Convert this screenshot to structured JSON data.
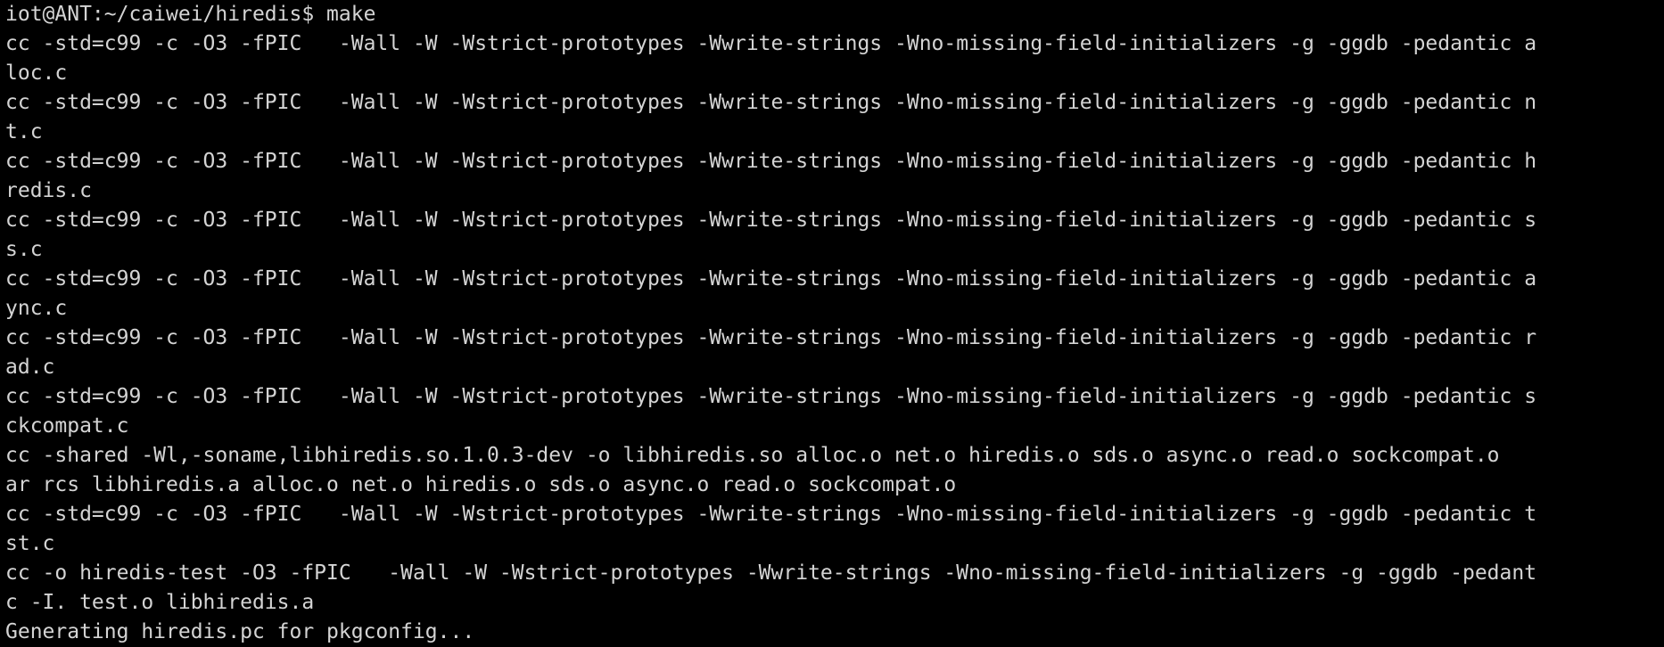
{
  "terminal": {
    "lines": [
      "iot@ANT:~/caiwei/hiredis$ make",
      "cc -std=c99 -c -O3 -fPIC   -Wall -W -Wstrict-prototypes -Wwrite-strings -Wno-missing-field-initializers -g -ggdb -pedantic a",
      "loc.c",
      "cc -std=c99 -c -O3 -fPIC   -Wall -W -Wstrict-prototypes -Wwrite-strings -Wno-missing-field-initializers -g -ggdb -pedantic n",
      "t.c",
      "cc -std=c99 -c -O3 -fPIC   -Wall -W -Wstrict-prototypes -Wwrite-strings -Wno-missing-field-initializers -g -ggdb -pedantic h",
      "redis.c",
      "cc -std=c99 -c -O3 -fPIC   -Wall -W -Wstrict-prototypes -Wwrite-strings -Wno-missing-field-initializers -g -ggdb -pedantic s",
      "s.c",
      "cc -std=c99 -c -O3 -fPIC   -Wall -W -Wstrict-prototypes -Wwrite-strings -Wno-missing-field-initializers -g -ggdb -pedantic a",
      "ync.c",
      "cc -std=c99 -c -O3 -fPIC   -Wall -W -Wstrict-prototypes -Wwrite-strings -Wno-missing-field-initializers -g -ggdb -pedantic r",
      "ad.c",
      "cc -std=c99 -c -O3 -fPIC   -Wall -W -Wstrict-prototypes -Wwrite-strings -Wno-missing-field-initializers -g -ggdb -pedantic s",
      "ckcompat.c",
      "cc -shared -Wl,-soname,libhiredis.so.1.0.3-dev -o libhiredis.so alloc.o net.o hiredis.o sds.o async.o read.o sockcompat.o",
      "ar rcs libhiredis.a alloc.o net.o hiredis.o sds.o async.o read.o sockcompat.o",
      "cc -std=c99 -c -O3 -fPIC   -Wall -W -Wstrict-prototypes -Wwrite-strings -Wno-missing-field-initializers -g -ggdb -pedantic t",
      "st.c",
      "cc -o hiredis-test -O3 -fPIC   -Wall -W -Wstrict-prototypes -Wwrite-strings -Wno-missing-field-initializers -g -ggdb -pedant",
      "c -I. test.o libhiredis.a",
      "Generating hiredis.pc for pkgconfig..."
    ]
  }
}
